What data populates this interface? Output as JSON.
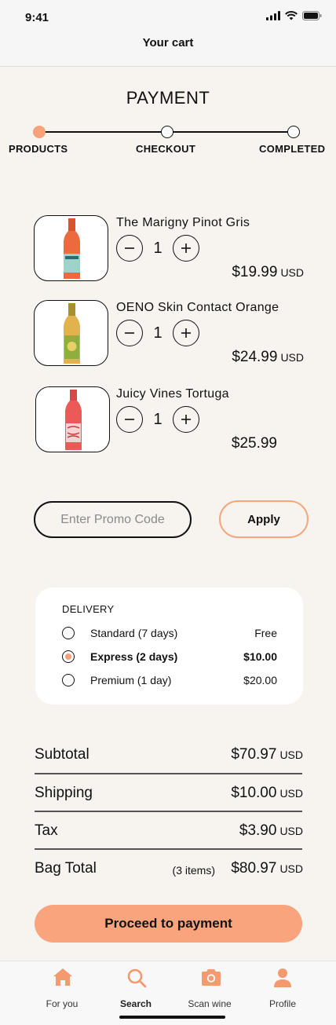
{
  "status_bar": {
    "time": "9:41"
  },
  "header": {
    "title": "Your cart"
  },
  "page": {
    "section_title": "PAYMENT"
  },
  "stepper": {
    "steps": [
      {
        "label": "PRODUCTS",
        "active": true
      },
      {
        "label": "CHECKOUT",
        "active": false
      },
      {
        "label": "COMPLETED",
        "active": false
      }
    ]
  },
  "cart": {
    "items": [
      {
        "name": "The Marigny Pinot Gris",
        "quantity": "1",
        "price": "$19.99",
        "currency": "USD"
      },
      {
        "name": "OENO Skin Contact Orange",
        "quantity": "1",
        "price": "$24.99",
        "currency": "USD"
      },
      {
        "name": "Juicy Vines Tortuga",
        "quantity": "1",
        "price": "$25.99",
        "currency": ""
      }
    ]
  },
  "promo": {
    "placeholder": "Enter Promo Code",
    "value": "",
    "apply_label": "Apply"
  },
  "delivery": {
    "title": "DELIVERY",
    "options": [
      {
        "label": "Standard (7 days)",
        "price": "Free",
        "selected": false
      },
      {
        "label": "Express (2 days)",
        "price": "$10.00",
        "selected": true
      },
      {
        "label": "Premium (1 day)",
        "price": "$20.00",
        "selected": false
      }
    ]
  },
  "summary": {
    "subtotal_label": "Subtotal",
    "subtotal_value": "$70.97",
    "subtotal_currency": "USD",
    "shipping_label": "Shipping",
    "shipping_value": "$10.00",
    "shipping_currency": "USD",
    "tax_label": "Tax",
    "tax_value": "$3.90",
    "tax_currency": "USD",
    "total_label": "Bag Total",
    "items_count": "(3 items)",
    "total_value": "$80.97",
    "total_currency": "USD"
  },
  "actions": {
    "proceed_label": "Proceed to payment"
  },
  "tab_bar": {
    "tabs": [
      {
        "label": "For you",
        "icon": "home-icon"
      },
      {
        "label": "Search",
        "icon": "search-icon"
      },
      {
        "label": "Scan wine",
        "icon": "camera-icon"
      },
      {
        "label": "Profile",
        "icon": "profile-icon"
      }
    ]
  },
  "colors": {
    "accent": "#f9a47c",
    "background": "#f7f3ee"
  }
}
